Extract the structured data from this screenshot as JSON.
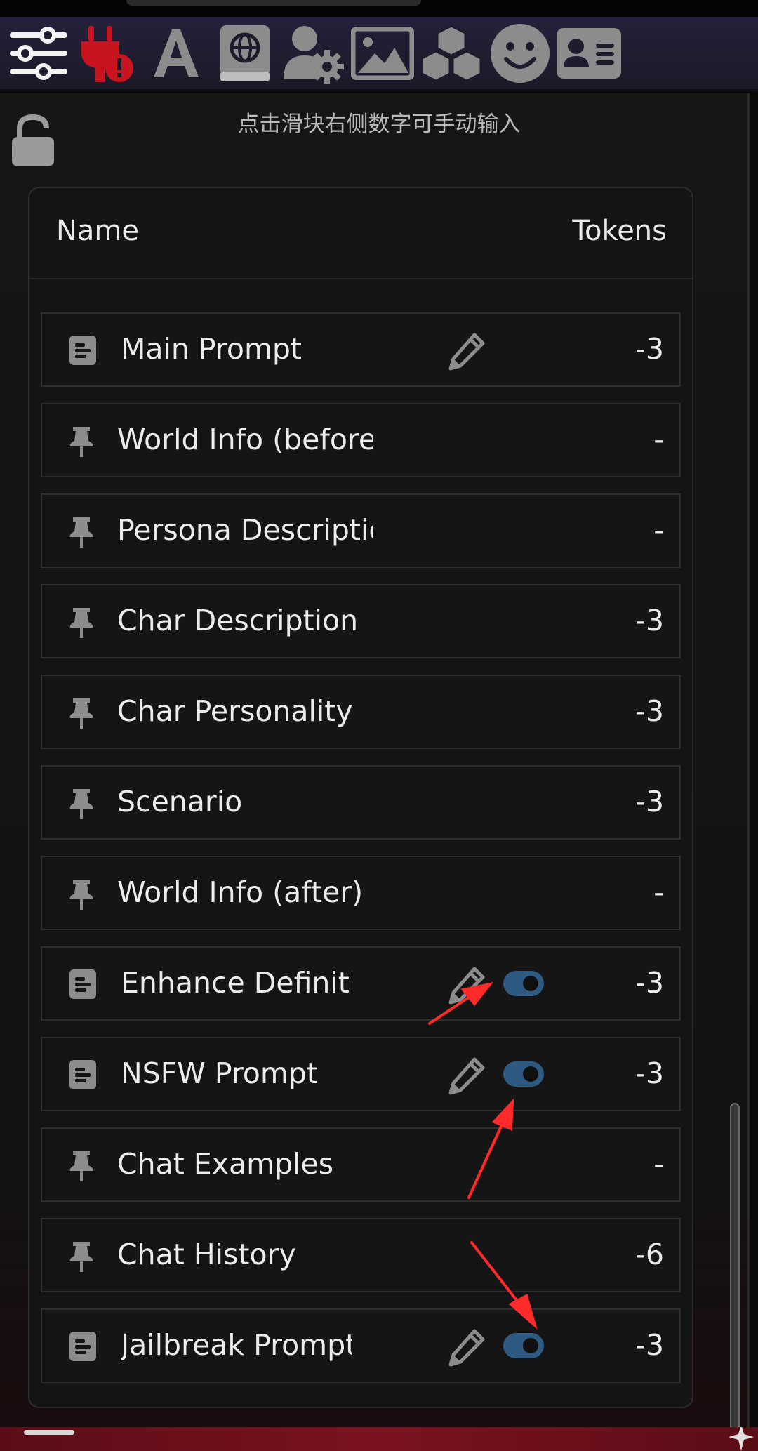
{
  "toolbar": {
    "items": [
      {
        "name": "ai-response-config",
        "icon": "sliders-icon"
      },
      {
        "name": "api-connections",
        "icon": "plug-error-icon"
      },
      {
        "name": "advanced-formatting",
        "icon": "font-a-icon"
      },
      {
        "name": "world-info",
        "icon": "globe-book-icon"
      },
      {
        "name": "user-settings",
        "icon": "user-gear-icon"
      },
      {
        "name": "backgrounds",
        "icon": "image-icon"
      },
      {
        "name": "extensions",
        "icon": "cubes-icon"
      },
      {
        "name": "persona",
        "icon": "smiley-icon"
      },
      {
        "name": "character-management",
        "icon": "id-card-icon"
      }
    ]
  },
  "hint": "点击滑块右侧数字可手动输入",
  "table": {
    "header_name": "Name",
    "header_tokens": "Tokens",
    "rows": [
      {
        "label": "Main Prompt",
        "type": "doc",
        "editable": true,
        "toggle": false,
        "tokens": "-3"
      },
      {
        "label": "World Info (before)",
        "type": "pin",
        "editable": false,
        "toggle": false,
        "tokens": "-"
      },
      {
        "label": "Persona Description",
        "type": "pin",
        "editable": false,
        "toggle": false,
        "tokens": "-"
      },
      {
        "label": "Char Description",
        "type": "pin",
        "editable": false,
        "toggle": false,
        "tokens": "-3",
        "wide": true
      },
      {
        "label": "Char Personality",
        "type": "pin",
        "editable": false,
        "toggle": false,
        "tokens": "-3",
        "wide": true
      },
      {
        "label": "Scenario",
        "type": "pin",
        "editable": false,
        "toggle": false,
        "tokens": "-3",
        "wide": true
      },
      {
        "label": "World Info (after)",
        "type": "pin",
        "editable": false,
        "toggle": false,
        "tokens": "-",
        "wide": true
      },
      {
        "label": "Enhance Definitions",
        "type": "doc",
        "editable": true,
        "toggle": true,
        "tokens": "-3"
      },
      {
        "label": "NSFW Prompt",
        "type": "doc",
        "editable": true,
        "toggle": true,
        "tokens": "-3"
      },
      {
        "label": "Chat Examples",
        "type": "pin",
        "editable": false,
        "toggle": false,
        "tokens": "-",
        "wide": true
      },
      {
        "label": "Chat History",
        "type": "pin",
        "editable": false,
        "toggle": false,
        "tokens": "-6",
        "wide": true
      },
      {
        "label": "Jailbreak Prompt",
        "type": "doc",
        "editable": true,
        "toggle": true,
        "tokens": "-3"
      }
    ]
  },
  "colors": {
    "toggle_on": "#2e5a82",
    "icon_gray": "#8c8c8c",
    "plug_red": "#c8141e",
    "annotation_red": "#ff2a2a"
  }
}
